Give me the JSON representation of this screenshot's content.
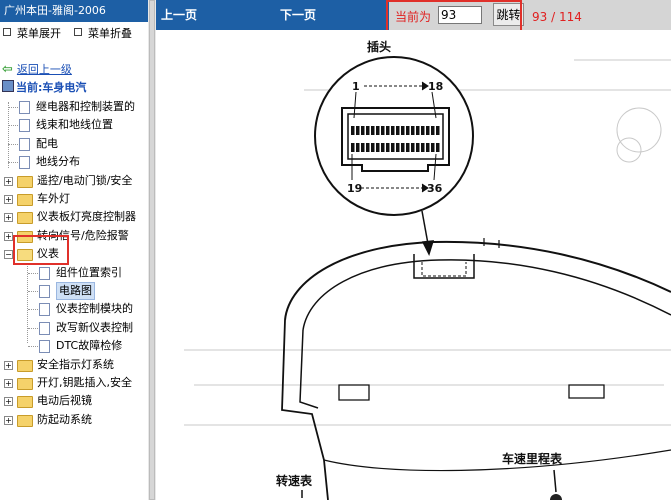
{
  "sidebar": {
    "title": "广州本田-雅阁-2006",
    "menu": {
      "expand_label": "菜单展开",
      "collapse_label": "菜单折叠"
    },
    "back_link": "返回上一级",
    "current": "当前:车身电汽",
    "tree": [
      {
        "label": "继电器和控制装置的",
        "type": "doc",
        "level": 0
      },
      {
        "label": "线束和地线位置",
        "type": "doc",
        "level": 0
      },
      {
        "label": "配电",
        "type": "doc",
        "level": 0
      },
      {
        "label": "地线分布",
        "type": "doc",
        "level": 0
      },
      {
        "label": "遥控/电动门锁/安全",
        "type": "folder",
        "level": 0
      },
      {
        "label": "车外灯",
        "type": "folder",
        "level": 0
      },
      {
        "label": "仪表板灯亮度控制器",
        "type": "folder",
        "level": 0
      },
      {
        "label": "转向信号/危险报警",
        "type": "folder",
        "level": 0
      },
      {
        "label": "仪表",
        "type": "folder-open",
        "level": 0
      },
      {
        "label": "组件位置索引",
        "type": "doc",
        "level": 1
      },
      {
        "label": "电路图",
        "type": "doc",
        "level": 1,
        "selected": true
      },
      {
        "label": "仪表控制模块的",
        "type": "doc",
        "level": 1
      },
      {
        "label": "改写新仪表控制",
        "type": "doc",
        "level": 1
      },
      {
        "label": "DTC故障检修",
        "type": "doc",
        "level": 1
      },
      {
        "label": "安全指示灯系统",
        "type": "folder",
        "level": 0
      },
      {
        "label": "开灯,钥匙插入,安全",
        "type": "folder",
        "level": 0
      },
      {
        "label": "电动后视镜",
        "type": "folder",
        "level": 0
      },
      {
        "label": "防起动系统",
        "type": "folder",
        "level": 0
      }
    ]
  },
  "toolbar": {
    "prev_label": "上一页",
    "next_label": "下一页",
    "current_label": "当前为",
    "page_value": "93",
    "jump_label": "跳转",
    "page_count": "93 / 114"
  },
  "diagram": {
    "connector_label": "插头",
    "pin_1": "1",
    "pin_18": "18",
    "pin_19": "19",
    "pin_36": "36",
    "tachometer_label": "转速表",
    "odometer_label": "车速里程表"
  },
  "colors": {
    "header_blue": "#1d5fa5",
    "highlight_red": "#e0302a",
    "page_text_red": "#e02020"
  }
}
